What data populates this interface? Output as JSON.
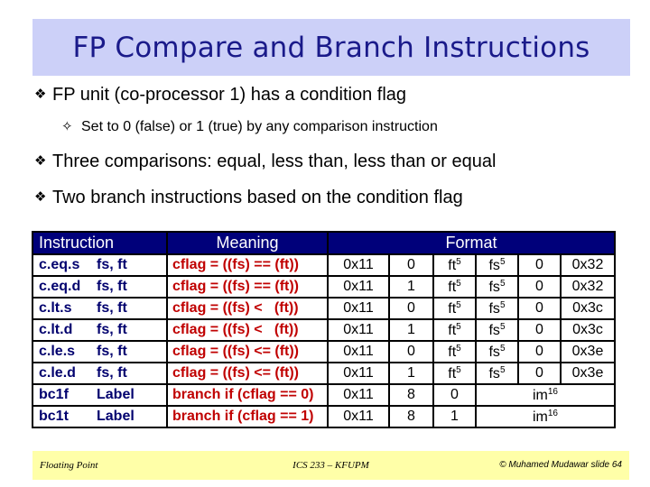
{
  "title": "FP Compare and Branch Instructions",
  "bullets": [
    {
      "glyph": "❖",
      "text": "FP unit (co-processor 1) has a condition flag"
    },
    {
      "glyph": "❖",
      "text": "Three comparisons: equal, less than, less than or equal"
    },
    {
      "glyph": "❖",
      "text": "Two branch instructions based on the condition flag"
    }
  ],
  "sub_bullets": [
    {
      "glyph": "✧",
      "text": "Set to 0 (false) or 1 (true) by any comparison instruction"
    }
  ],
  "table": {
    "headers": {
      "instruction": "Instruction",
      "meaning": "Meaning",
      "format": "Format"
    },
    "rows": [
      {
        "op": "c.eq.s",
        "args": "fs, ft",
        "meaning": "cflag = ((fs) == (ft))",
        "f1": "0x11",
        "f2": "0",
        "f3": "ft",
        "f3sup": "5",
        "f4": "fs",
        "f4sup": "5",
        "f5": "0",
        "f6": "0x32"
      },
      {
        "op": "c.eq.d",
        "args": "fs, ft",
        "meaning": "cflag = ((fs) == (ft))",
        "f1": "0x11",
        "f2": "1",
        "f3": "ft",
        "f3sup": "5",
        "f4": "fs",
        "f4sup": "5",
        "f5": "0",
        "f6": "0x32"
      },
      {
        "op": "c.lt.s",
        "args": "fs, ft",
        "meaning": "cflag = ((fs) <   (ft))",
        "f1": "0x11",
        "f2": "0",
        "f3": "ft",
        "f3sup": "5",
        "f4": "fs",
        "f4sup": "5",
        "f5": "0",
        "f6": "0x3c"
      },
      {
        "op": "c.lt.d",
        "args": "fs, ft",
        "meaning": "cflag = ((fs) <   (ft))",
        "f1": "0x11",
        "f2": "1",
        "f3": "ft",
        "f3sup": "5",
        "f4": "fs",
        "f4sup": "5",
        "f5": "0",
        "f6": "0x3c"
      },
      {
        "op": "c.le.s",
        "args": "fs, ft",
        "meaning": "cflag = ((fs) <= (ft))",
        "f1": "0x11",
        "f2": "0",
        "f3": "ft",
        "f3sup": "5",
        "f4": "fs",
        "f4sup": "5",
        "f5": "0",
        "f6": "0x3e"
      },
      {
        "op": "c.le.d",
        "args": "fs, ft",
        "meaning": "cflag = ((fs) <= (ft))",
        "f1": "0x11",
        "f2": "1",
        "f3": "ft",
        "f3sup": "5",
        "f4": "fs",
        "f4sup": "5",
        "f5": "0",
        "f6": "0x3e"
      },
      {
        "op": "bc1f",
        "args": "Label",
        "meaning": "branch if (cflag == 0)",
        "f1": "0x11",
        "f2": "8",
        "f3": "0",
        "imm": "im",
        "immsup": "16"
      },
      {
        "op": "bc1t",
        "args": "Label",
        "meaning": "branch if (cflag == 1)",
        "f1": "0x11",
        "f2": "8",
        "f3": "1",
        "imm": "im",
        "immsup": "16"
      }
    ]
  },
  "footer": {
    "left": "Floating Point",
    "center": "ICS 233 – KFUPM",
    "right": "© Muhamed Mudawar  slide 64"
  }
}
